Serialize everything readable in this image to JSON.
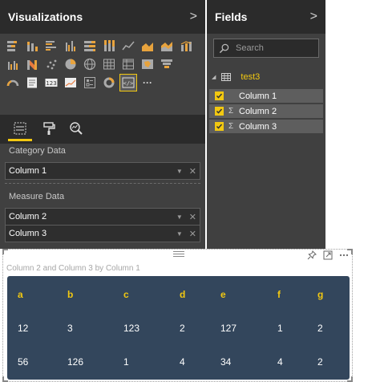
{
  "visualizations": {
    "title": "Visualizations",
    "icons": [
      "stacked-bar-icon",
      "stacked-column-icon",
      "clustered-bar-icon",
      "clustered-column-icon",
      "100-bar-icon",
      "100-column-icon",
      "line-chart-icon",
      "area-chart-icon",
      "stacked-area-icon",
      "line-column-icon",
      "line-clustered-column-icon",
      "ribbon-chart-icon",
      "scatter-chart-icon",
      "pie-chart-icon",
      "map-icon",
      "table-icon",
      "matrix-icon",
      "filled-map-icon",
      "funnel-icon",
      "gauge-icon",
      "multirow-card-icon",
      "card-icon",
      "kpi-icon",
      "slicer-icon",
      "donut-icon",
      "custom-visual-icon",
      "more-icon"
    ],
    "card_text": "123",
    "more_glyph": "···",
    "category_label": "Category Data",
    "category_fields": [
      "Column 1"
    ],
    "measure_label": "Measure Data",
    "measure_fields": [
      "Column 2",
      "Column 3"
    ]
  },
  "fields": {
    "title": "Fields",
    "search_placeholder": "Search",
    "table_name": "test3",
    "columns": [
      {
        "name": "Column 1",
        "checked": true,
        "sigma": false
      },
      {
        "name": "Column 2",
        "checked": true,
        "sigma": true
      },
      {
        "name": "Column 3",
        "checked": true,
        "sigma": true
      }
    ]
  },
  "visual": {
    "title": "Column 2 and Column 3 by Column 1",
    "headers": [
      "a",
      "b",
      "c",
      "d",
      "e",
      "f",
      "g"
    ],
    "rows": [
      [
        "12",
        "3",
        "123",
        "2",
        "127",
        "1",
        "2"
      ],
      [
        "56",
        "126",
        "1",
        "4",
        "34",
        "4",
        "2"
      ]
    ]
  },
  "colors": {
    "accent": "#f2c811",
    "pane_bg": "#404040",
    "header_bg": "#2b2b2b",
    "table_bg": "#33465c"
  },
  "glyphs": {
    "chevron": ">",
    "expand": "◢",
    "dropdown": "▼",
    "remove": "✕",
    "sigma": "Σ"
  }
}
